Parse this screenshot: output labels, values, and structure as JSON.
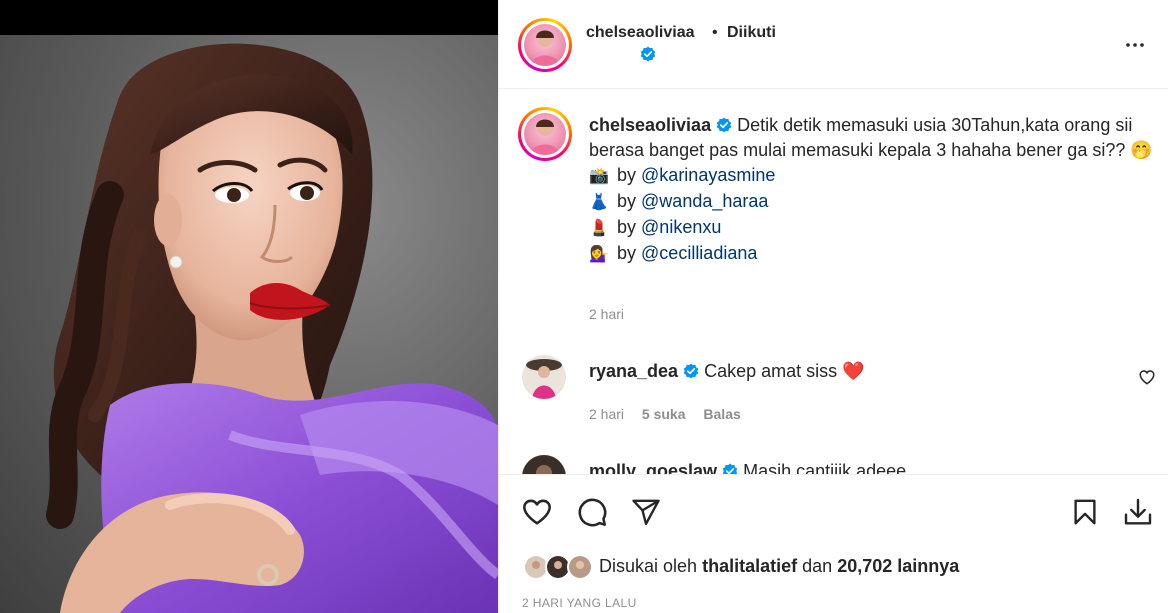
{
  "header": {
    "username": "chelseaoliviaa",
    "separator": "•",
    "follow_status": "Diikuti",
    "more_icon": "more-horizontal-icon"
  },
  "caption": {
    "username": "chelseaoliviaa",
    "text": "Detik detik memasuki usia 30Tahun,kata orang sii berasa banget pas mulai memasuki kepala 3 hahaha bener ga si?? 🤭",
    "credits": [
      {
        "emoji": "📸",
        "by": "by",
        "mention": "@karinayasmine"
      },
      {
        "emoji": "👗",
        "by": "by",
        "mention": "@wanda_haraa"
      },
      {
        "emoji": "💄",
        "by": "by",
        "mention": "@nikenxu"
      },
      {
        "emoji": "💁‍♀️",
        "by": "by",
        "mention": "@cecilliadiana"
      }
    ],
    "time": "2 hari"
  },
  "comments": [
    {
      "username": "ryana_dea",
      "text": "Cakep amat siss ❤️",
      "time": "2 hari",
      "likes": "5 suka",
      "reply": "Balas"
    },
    {
      "username": "molly_goeslaw",
      "text": "Masih cantiiik adeee",
      "time": "",
      "likes": "",
      "reply": ""
    }
  ],
  "actions": {
    "like_icon": "heart-icon",
    "comment_icon": "comment-icon",
    "share_icon": "send-icon",
    "save_icon": "bookmark-icon",
    "download_icon": "download-icon"
  },
  "likes": {
    "prefix": "Disukai oleh",
    "user": "thalitalatief",
    "middle": "dan",
    "count": "20,702",
    "suffix": "lainnya"
  },
  "date": "2 HARI YANG LALU",
  "colors": {
    "verified": "#0095f6",
    "mention": "#00376b",
    "muted": "#8e8e8e",
    "heart_red": "#ed4956",
    "dress_purple": "#8b4fd6"
  }
}
